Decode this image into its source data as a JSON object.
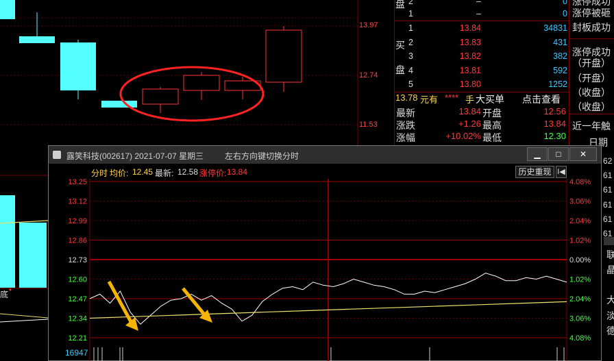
{
  "price_axis": {
    "top": "13.97",
    "mid": "12.74",
    "bottom": "11.53"
  },
  "bottom_marker": "底",
  "order_book": {
    "sell_partial": [
      {
        "idx": "2",
        "price": "–",
        "vol": "0"
      },
      {
        "idx": "1",
        "price": "–",
        "vol": "0"
      }
    ],
    "buy_label_1": "买",
    "buy_label_2": "盘",
    "sell_fragment": "盘",
    "buy": [
      {
        "idx": "1",
        "price": "13.84",
        "vol": "34831"
      },
      {
        "idx": "2",
        "price": "13.83",
        "vol": "431"
      },
      {
        "idx": "3",
        "price": "13.82",
        "vol": "382"
      },
      {
        "idx": "4",
        "price": "13.81",
        "vol": "592"
      },
      {
        "idx": "5",
        "price": "13.80",
        "vol": "1252"
      }
    ]
  },
  "summary": {
    "price": "13.78",
    "unit": "元有",
    "hidden": "****",
    "hand": "手",
    "big_buy": "大买单",
    "click_view": "点击查看"
  },
  "stats": [
    {
      "l1": "最新",
      "v1": "13.84",
      "l2": "开盘",
      "v2": "12.56"
    },
    {
      "l1": "涨跌",
      "v1": "+1.26",
      "l2": "最高",
      "v2": "13.84"
    },
    {
      "l1": "涨幅",
      "v1": "+10.02%",
      "l2": "最低",
      "v2": "12.30"
    }
  ],
  "right_panel": {
    "lines": [
      "涨停被砸",
      "封板成功",
      "涨停成功",
      "（开盘）",
      "（开盘）",
      "（收盘）",
      "（收盘）",
      "近一年触",
      "日期"
    ],
    "top_line": "涨停成功",
    "codes": [
      "62",
      "61",
      "61",
      "61",
      "61",
      "61",
      "61"
    ],
    "vert": [
      "联",
      "晶",
      "大",
      "淡",
      "德"
    ]
  },
  "popup": {
    "title": "露笑科技(002617)  2021-07-07  星期三",
    "hint": "左右方向键切换分时",
    "btn_min": "▁",
    "btn_max": "□",
    "btn_close": "✕",
    "info": {
      "label_fenshi": "分时",
      "label_avg": "均价:",
      "avg": "12.45",
      "label_latest": "最新:",
      "latest": "12.58",
      "label_limit": "涨停价:",
      "limit": "13.84"
    },
    "history_btn": "历史重现",
    "history_icon": "I◀",
    "volume_label": "16947"
  },
  "chart_data": {
    "type": "line",
    "y_ticks_price": [
      "13.25",
      "13.12",
      "12.99",
      "12.86",
      "12.73",
      "12.60",
      "12.47",
      "12.34",
      "12.21"
    ],
    "y_ticks_pct": [
      "4.08%",
      "3.06%",
      "2.04%",
      "1.02%",
      "0.00%",
      "1.02%",
      "2.04%",
      "3.06%",
      "4.08%"
    ],
    "ylim": [
      12.21,
      13.25
    ],
    "base_price": 12.73,
    "series": [
      {
        "values": [
          12.47,
          12.5,
          12.44,
          12.52,
          12.38,
          12.3,
          12.36,
          12.42,
          12.46,
          12.47,
          12.5,
          12.46,
          12.49,
          12.44,
          12.4,
          12.32,
          12.36,
          12.45,
          12.5,
          12.54,
          12.55,
          12.53,
          12.58,
          12.56,
          12.55,
          12.57,
          12.6,
          12.58,
          12.56,
          12.55,
          12.53,
          12.5,
          12.5,
          12.52,
          12.51,
          12.53,
          12.55,
          12.57,
          12.6,
          12.64,
          12.62,
          12.59,
          12.59,
          12.61,
          12.6,
          12.62,
          12.6,
          12.58
        ]
      },
      {
        "values": [
          12.34,
          12.35,
          12.36,
          12.37,
          12.38,
          12.39,
          12.4,
          12.41,
          12.42,
          12.43,
          12.44,
          12.45
        ]
      }
    ]
  }
}
